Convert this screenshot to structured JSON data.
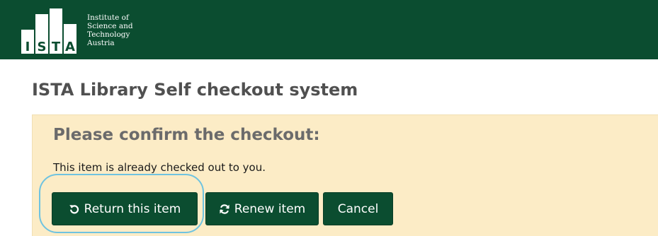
{
  "header": {
    "logo": {
      "letters": [
        "I",
        "S",
        "T",
        "A"
      ],
      "text_lines": [
        "Institute of",
        "Science and",
        "Technology",
        "Austria"
      ],
      "icon": "ista-logo"
    },
    "background_color": "#0b4d30"
  },
  "page": {
    "title": "ISTA Library Self checkout system"
  },
  "confirm_panel": {
    "heading": "Please confirm the checkout:",
    "message": "This item is already checked out to you.",
    "background_color": "#fcecc6",
    "buttons": {
      "return": {
        "label": "Return this item",
        "icon": "undo-icon"
      },
      "renew": {
        "label": "Renew item",
        "icon": "refresh-icon"
      },
      "cancel": {
        "label": "Cancel"
      }
    },
    "button_color": "#0b4d30"
  },
  "highlight": {
    "target": "return-this-item-button",
    "color": "#6fc3e0"
  }
}
